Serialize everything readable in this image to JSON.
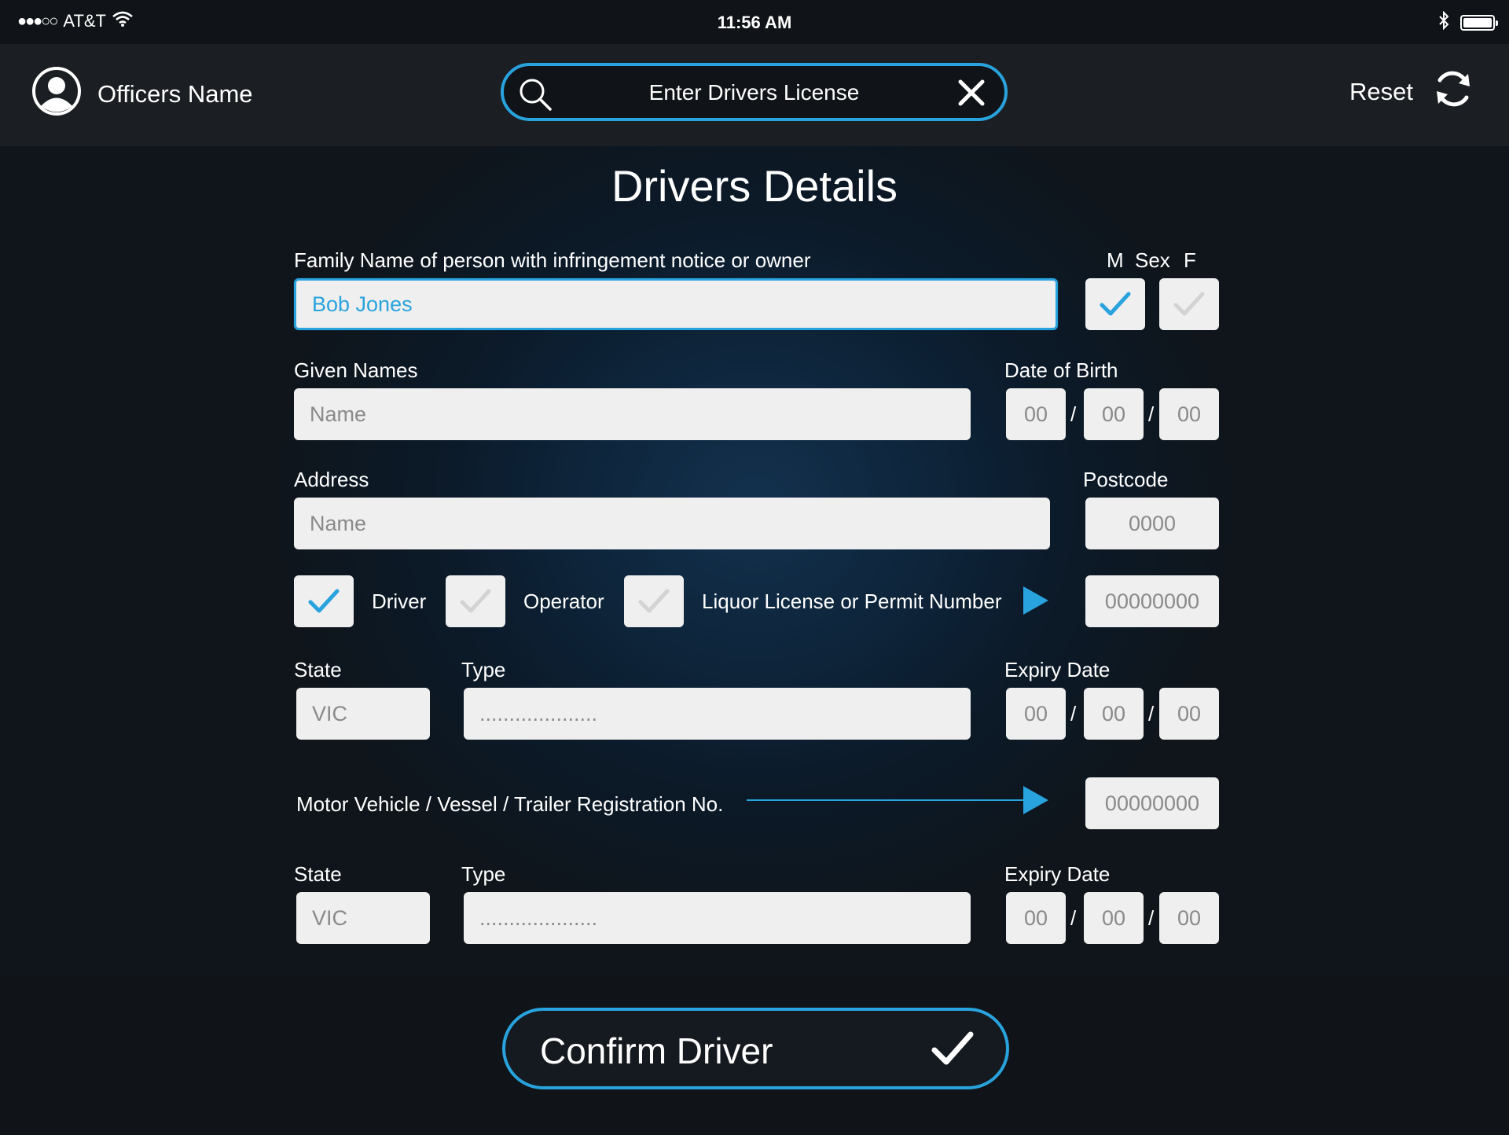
{
  "status_bar": {
    "signal": "●●●○○",
    "carrier": "AT&T",
    "time": "11:56 AM"
  },
  "header": {
    "officer_name": "Officers Name",
    "search_placeholder": "Enter Drivers License",
    "reset_label": "Reset"
  },
  "form": {
    "title": "Drivers Details",
    "family_name": {
      "label": "Family Name of person with infringement notice or owner",
      "value": "Bob Jones"
    },
    "sex": {
      "label": "Sex",
      "male": "M",
      "female": "F",
      "male_checked": true,
      "female_checked": false
    },
    "given_names": {
      "label": "Given Names",
      "placeholder": "Name"
    },
    "dob": {
      "label": "Date of Birth",
      "day": "00",
      "month": "00",
      "year": "00",
      "separator": "/"
    },
    "address": {
      "label": "Address",
      "placeholder": "Name"
    },
    "postcode": {
      "label": "Postcode",
      "placeholder": "0000"
    },
    "role": {
      "driver_label": "Driver",
      "driver_checked": true,
      "operator_label": "Operator",
      "operator_checked": false,
      "liquor_checked": false,
      "liquor_label": "Liquor License or Permit Number",
      "license_number_placeholder": "00000000"
    },
    "license": {
      "state_label": "State",
      "state_value": "VIC",
      "type_label": "Type",
      "type_value": "....................",
      "expiry_label": "Expiry Date",
      "day": "00",
      "month": "00",
      "year": "00"
    },
    "registration": {
      "label": "Motor Vehicle / Vessel / Trailer Registration No.",
      "placeholder": "00000000"
    },
    "registration_details": {
      "state_label": "State",
      "state_value": "VIC",
      "type_label": "Type",
      "type_value": "....................",
      "expiry_label": "Expiry Date",
      "day": "00",
      "month": "00",
      "year": "00"
    }
  },
  "footer": {
    "confirm_label": "Confirm Driver"
  },
  "colors": {
    "accent": "#29a3dd",
    "header_bg": "#1b1e22",
    "field_bg": "#efefef"
  },
  "icons": [
    "wifi-icon",
    "bluetooth-icon",
    "battery-icon",
    "user-avatar-icon",
    "search-icon",
    "close-icon",
    "refresh-icon",
    "checkmark-icon",
    "play-arrow-icon"
  ]
}
